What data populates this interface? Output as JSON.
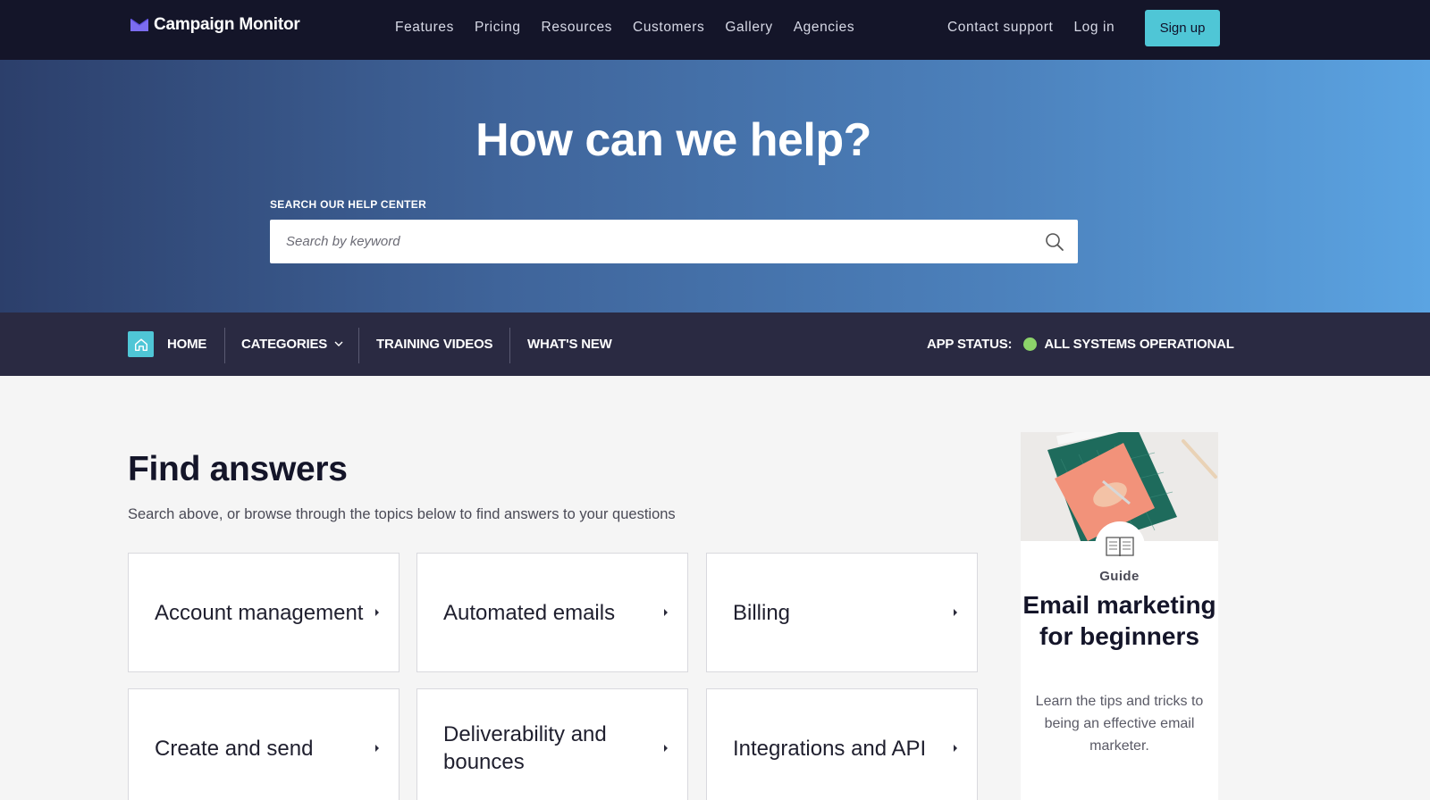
{
  "topnav": {
    "logo_text": "Campaign Monitor",
    "links": [
      "Features",
      "Pricing",
      "Resources",
      "Customers",
      "Gallery",
      "Agencies"
    ],
    "contact_support": "Contact support",
    "login": "Log in",
    "signup": "Sign up"
  },
  "hero": {
    "title": "How can we help?",
    "search_label": "SEARCH OUR HELP CENTER",
    "search_placeholder": "Search by keyword"
  },
  "subnav": {
    "home": "HOME",
    "categories": "CATEGORIES",
    "training_videos": "TRAINING VIDEOS",
    "whats_new": "WHAT'S NEW",
    "app_status_label": "APP STATUS:",
    "app_status_value": "ALL SYSTEMS OPERATIONAL"
  },
  "main": {
    "title": "Find answers",
    "subtitle": "Search above, or browse through the topics below to find answers to your questions",
    "cards": [
      "Account management",
      "Automated emails",
      "Billing",
      "Create and send",
      "Deliverability and bounces",
      "Integrations and API"
    ]
  },
  "guide": {
    "tag": "Guide",
    "title": "Email marketing for beginners",
    "description": "Learn the tips and tricks to being an effective email marketer."
  },
  "colors": {
    "topnav_bg": "#141529",
    "accent": "#4fc6d6",
    "subnav_bg": "#2a2a42",
    "status_ok": "#8cd36a"
  },
  "icons": {
    "logo": "envelope-logo-icon",
    "search": "search-icon",
    "home": "home-icon",
    "categories_chevron": "chevron-down-icon",
    "status": "status-dot-icon",
    "guide": "open-book-icon"
  }
}
